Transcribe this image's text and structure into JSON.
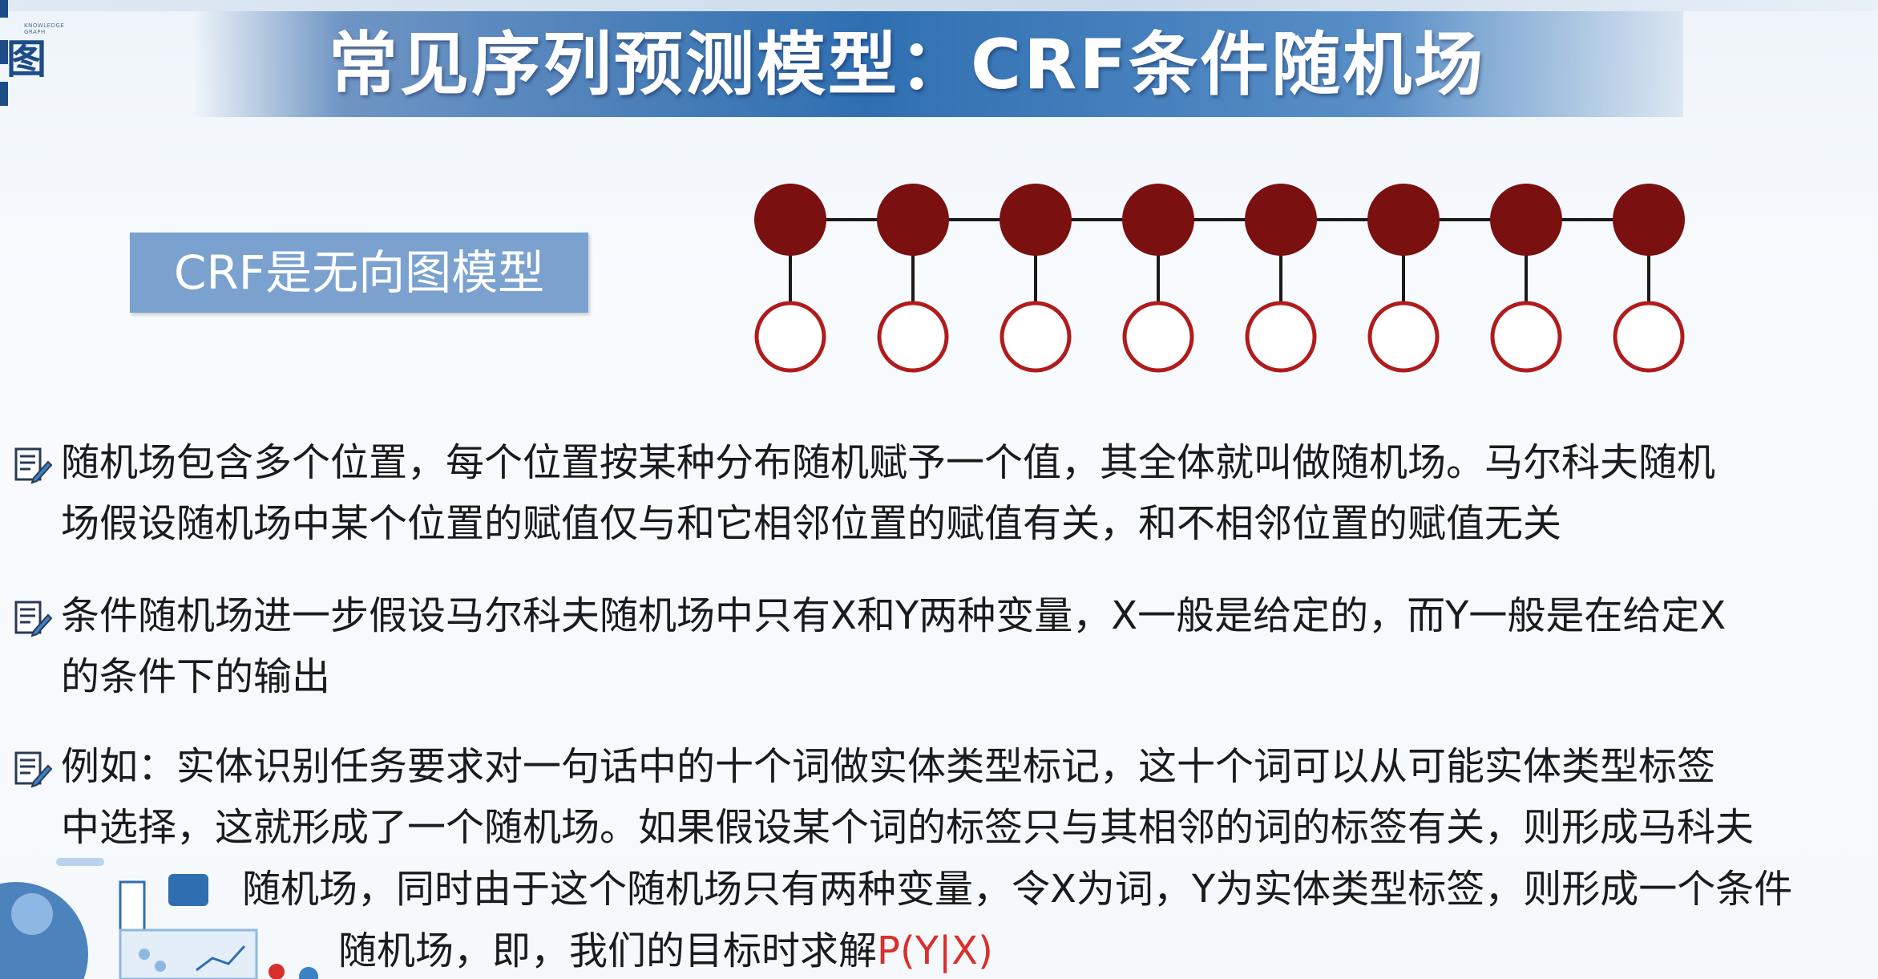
{
  "slide": {
    "title": "常见序列预测模型：CRF条件随机场",
    "label": "CRF是无向图模型",
    "logo_char": "图",
    "logo_small": [
      "KNOWLEDGE",
      "GRAPH"
    ],
    "colors": {
      "title_blue": "#2f6fb1",
      "label_bg": "#7ba2cf",
      "node_fill": "#7a1010",
      "node_outline": "#b01c1c",
      "highlight": "#d9302c"
    }
  },
  "diagram": {
    "hidden_nodes": 8,
    "observed_nodes": 8
  },
  "paragraphs": [
    {
      "icon": "note-edit-icon",
      "lines": [
        "随机场包含多个位置，每个位置按某种分布随机赋予一个值，其全体就叫做随机场。马尔科夫随机",
        "场假设随机场中某个位置的赋值仅与和它相邻位置的赋值有关，和不相邻位置的赋值无关"
      ]
    },
    {
      "icon": "note-edit-icon",
      "lines": [
        "条件随机场进一步假设马尔科夫随机场中只有X和Y两种变量，X一般是给定的，而Y一般是在给定X",
        "的条件下的输出"
      ]
    },
    {
      "icon": "note-edit-icon",
      "lines": [
        "例如：实体识别任务要求对一句话中的十个词做实体类型标记，这十个词可以从可能实体类型标签",
        "中选择，这就形成了一个随机场。如果假设某个词的标签只与其相邻的词的标签有关，则形成马科夫",
        "随机场，同时由于这个随机场只有两种变量，令X为词，Y为实体类型标签，则形成一个条件",
        "随机场，即，我们的目标时求解"
      ],
      "formula": "P(Y|X)"
    }
  ]
}
